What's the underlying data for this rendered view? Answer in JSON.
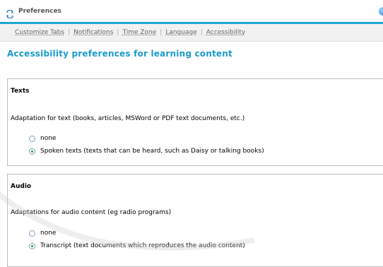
{
  "window": {
    "title": "Preferences",
    "icons": {
      "title_icon": "preferences-icon",
      "corner_icon": "globe-icon"
    },
    "accent_color": "#1ea7d2"
  },
  "tabs": [
    {
      "label": "Customize Tabs"
    },
    {
      "label": "Notifications"
    },
    {
      "label": "Time Zone"
    },
    {
      "label": "Language"
    },
    {
      "label": "Accessibility"
    }
  ],
  "page": {
    "heading": "Accessibility preferences for learning content",
    "heading_color": "#1a9bc9"
  },
  "sections": {
    "texts": {
      "title": "Texts",
      "description": "Adaptation for text (books, articles, MSWord or PDF text documents, etc.)",
      "options": [
        {
          "label": "none",
          "selected": false
        },
        {
          "label": "Spoken texts (texts that can be heard, such as Daisy or talking books)",
          "selected": true
        }
      ]
    },
    "audio": {
      "title": "Audio",
      "description": "Adaptations for audio content (eg radio programs)",
      "options": [
        {
          "label": "none",
          "selected": false
        },
        {
          "label": "Transcript (text documents which reproduces the audio content)",
          "selected": true
        }
      ]
    }
  }
}
